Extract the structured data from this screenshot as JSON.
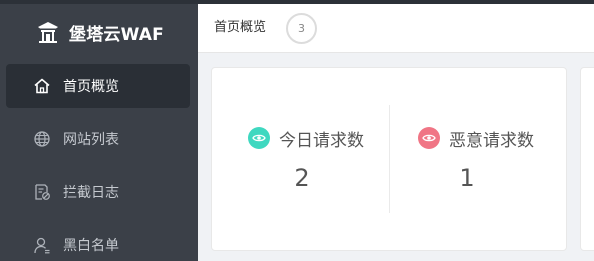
{
  "app": {
    "name": "堡塔云WAF",
    "logo_icon": "pagoda-logo-icon"
  },
  "sidebar": {
    "items": [
      {
        "label": "首页概览",
        "icon": "home-icon",
        "active": true
      },
      {
        "label": "网站列表",
        "icon": "globe-icon",
        "active": false
      },
      {
        "label": "拦截日志",
        "icon": "log-icon",
        "active": false
      },
      {
        "label": "黑白名单",
        "icon": "user-icon",
        "active": false
      }
    ]
  },
  "topbar": {
    "breadcrumb": "首页概览",
    "badge_count": "3"
  },
  "stats": [
    {
      "title": "今日请求数",
      "value": "2",
      "icon": "eye-icon",
      "color": "#3fd8c0"
    },
    {
      "title": "恶意请求数",
      "value": "1",
      "icon": "eye-icon",
      "color": "#f07585"
    }
  ],
  "colors": {
    "sidebar_bg": "#3b4048",
    "sidebar_active": "#2a2f36",
    "teal_accent": "#3fd8c0",
    "pink_accent": "#f07585"
  }
}
